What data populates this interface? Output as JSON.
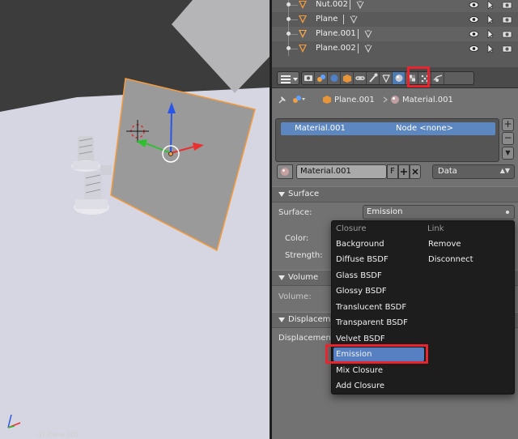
{
  "outliner": {
    "rows": [
      {
        "name": "Nut.002"
      },
      {
        "name": "Plane"
      },
      {
        "name": "Plane.001"
      },
      {
        "name": "Plane.002"
      }
    ]
  },
  "breadcrumb": {
    "object": "Plane.001",
    "material": "Material.001"
  },
  "material_slots": {
    "selected_name": "Material.001",
    "node": "Node <none>",
    "add": "+",
    "remove": "−",
    "down": "▼"
  },
  "material_datablock": {
    "name": "Material.001",
    "fake_user": "F",
    "link_mode": "Data"
  },
  "panels": {
    "surface": {
      "title": "Surface",
      "surface_label": "Surface:",
      "surface_value": "Emission",
      "color_label": "Color:",
      "strength_label": "Strength:"
    },
    "volume": {
      "title": "Volume",
      "volume_label": "Volume:"
    },
    "displacement": {
      "title": "Displacement",
      "displacement_label": "Displacement:"
    }
  },
  "menu": {
    "closure_header": "Closure",
    "link_header": "Link",
    "closures": [
      "Background",
      "Diffuse BSDF",
      "Glass BSDF",
      "Glossy BSDF",
      "Translucent BSDF",
      "Transparent BSDF",
      "Velvet BSDF",
      "Emission",
      "Mix Closure",
      "Add Closure"
    ],
    "links": [
      "Remove",
      "Disconnect"
    ],
    "highlighted": "Emission"
  },
  "viewport": {
    "object_label": "(1) Plane.001"
  },
  "colors": {
    "accent_blue": "#5680c2",
    "selection_orange": "#f39a3c",
    "highlight_red": "#e8242e"
  }
}
